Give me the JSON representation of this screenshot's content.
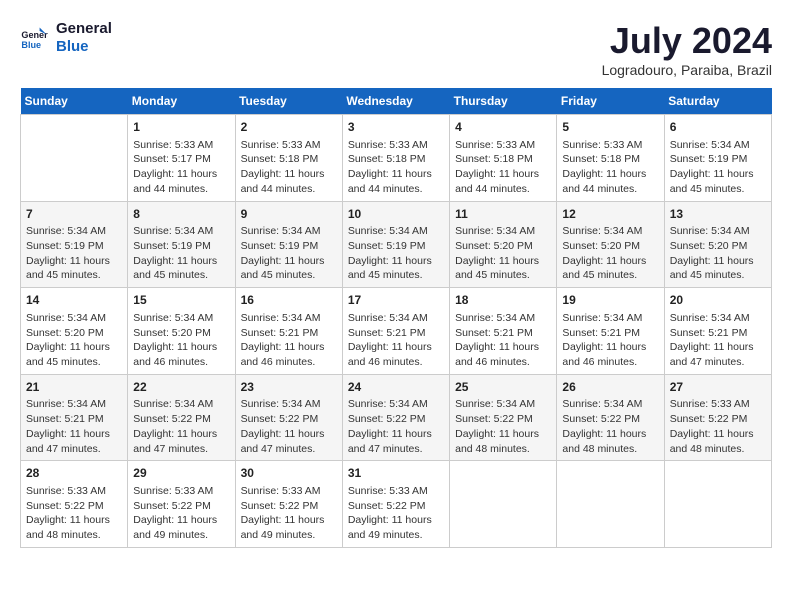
{
  "logo": {
    "line1": "General",
    "line2": "Blue"
  },
  "title": "July 2024",
  "location": "Logradouro, Paraiba, Brazil",
  "days_of_week": [
    "Sunday",
    "Monday",
    "Tuesday",
    "Wednesday",
    "Thursday",
    "Friday",
    "Saturday"
  ],
  "weeks": [
    [
      {
        "day": "",
        "info": ""
      },
      {
        "day": "1",
        "info": "Sunrise: 5:33 AM\nSunset: 5:17 PM\nDaylight: 11 hours\nand 44 minutes."
      },
      {
        "day": "2",
        "info": "Sunrise: 5:33 AM\nSunset: 5:18 PM\nDaylight: 11 hours\nand 44 minutes."
      },
      {
        "day": "3",
        "info": "Sunrise: 5:33 AM\nSunset: 5:18 PM\nDaylight: 11 hours\nand 44 minutes."
      },
      {
        "day": "4",
        "info": "Sunrise: 5:33 AM\nSunset: 5:18 PM\nDaylight: 11 hours\nand 44 minutes."
      },
      {
        "day": "5",
        "info": "Sunrise: 5:33 AM\nSunset: 5:18 PM\nDaylight: 11 hours\nand 44 minutes."
      },
      {
        "day": "6",
        "info": "Sunrise: 5:34 AM\nSunset: 5:19 PM\nDaylight: 11 hours\nand 45 minutes."
      }
    ],
    [
      {
        "day": "7",
        "info": "Sunrise: 5:34 AM\nSunset: 5:19 PM\nDaylight: 11 hours\nand 45 minutes."
      },
      {
        "day": "8",
        "info": "Sunrise: 5:34 AM\nSunset: 5:19 PM\nDaylight: 11 hours\nand 45 minutes."
      },
      {
        "day": "9",
        "info": "Sunrise: 5:34 AM\nSunset: 5:19 PM\nDaylight: 11 hours\nand 45 minutes."
      },
      {
        "day": "10",
        "info": "Sunrise: 5:34 AM\nSunset: 5:19 PM\nDaylight: 11 hours\nand 45 minutes."
      },
      {
        "day": "11",
        "info": "Sunrise: 5:34 AM\nSunset: 5:20 PM\nDaylight: 11 hours\nand 45 minutes."
      },
      {
        "day": "12",
        "info": "Sunrise: 5:34 AM\nSunset: 5:20 PM\nDaylight: 11 hours\nand 45 minutes."
      },
      {
        "day": "13",
        "info": "Sunrise: 5:34 AM\nSunset: 5:20 PM\nDaylight: 11 hours\nand 45 minutes."
      }
    ],
    [
      {
        "day": "14",
        "info": "Sunrise: 5:34 AM\nSunset: 5:20 PM\nDaylight: 11 hours\nand 45 minutes."
      },
      {
        "day": "15",
        "info": "Sunrise: 5:34 AM\nSunset: 5:20 PM\nDaylight: 11 hours\nand 46 minutes."
      },
      {
        "day": "16",
        "info": "Sunrise: 5:34 AM\nSunset: 5:21 PM\nDaylight: 11 hours\nand 46 minutes."
      },
      {
        "day": "17",
        "info": "Sunrise: 5:34 AM\nSunset: 5:21 PM\nDaylight: 11 hours\nand 46 minutes."
      },
      {
        "day": "18",
        "info": "Sunrise: 5:34 AM\nSunset: 5:21 PM\nDaylight: 11 hours\nand 46 minutes."
      },
      {
        "day": "19",
        "info": "Sunrise: 5:34 AM\nSunset: 5:21 PM\nDaylight: 11 hours\nand 46 minutes."
      },
      {
        "day": "20",
        "info": "Sunrise: 5:34 AM\nSunset: 5:21 PM\nDaylight: 11 hours\nand 47 minutes."
      }
    ],
    [
      {
        "day": "21",
        "info": "Sunrise: 5:34 AM\nSunset: 5:21 PM\nDaylight: 11 hours\nand 47 minutes."
      },
      {
        "day": "22",
        "info": "Sunrise: 5:34 AM\nSunset: 5:22 PM\nDaylight: 11 hours\nand 47 minutes."
      },
      {
        "day": "23",
        "info": "Sunrise: 5:34 AM\nSunset: 5:22 PM\nDaylight: 11 hours\nand 47 minutes."
      },
      {
        "day": "24",
        "info": "Sunrise: 5:34 AM\nSunset: 5:22 PM\nDaylight: 11 hours\nand 47 minutes."
      },
      {
        "day": "25",
        "info": "Sunrise: 5:34 AM\nSunset: 5:22 PM\nDaylight: 11 hours\nand 48 minutes."
      },
      {
        "day": "26",
        "info": "Sunrise: 5:34 AM\nSunset: 5:22 PM\nDaylight: 11 hours\nand 48 minutes."
      },
      {
        "day": "27",
        "info": "Sunrise: 5:33 AM\nSunset: 5:22 PM\nDaylight: 11 hours\nand 48 minutes."
      }
    ],
    [
      {
        "day": "28",
        "info": "Sunrise: 5:33 AM\nSunset: 5:22 PM\nDaylight: 11 hours\nand 48 minutes."
      },
      {
        "day": "29",
        "info": "Sunrise: 5:33 AM\nSunset: 5:22 PM\nDaylight: 11 hours\nand 49 minutes."
      },
      {
        "day": "30",
        "info": "Sunrise: 5:33 AM\nSunset: 5:22 PM\nDaylight: 11 hours\nand 49 minutes."
      },
      {
        "day": "31",
        "info": "Sunrise: 5:33 AM\nSunset: 5:22 PM\nDaylight: 11 hours\nand 49 minutes."
      },
      {
        "day": "",
        "info": ""
      },
      {
        "day": "",
        "info": ""
      },
      {
        "day": "",
        "info": ""
      }
    ]
  ]
}
